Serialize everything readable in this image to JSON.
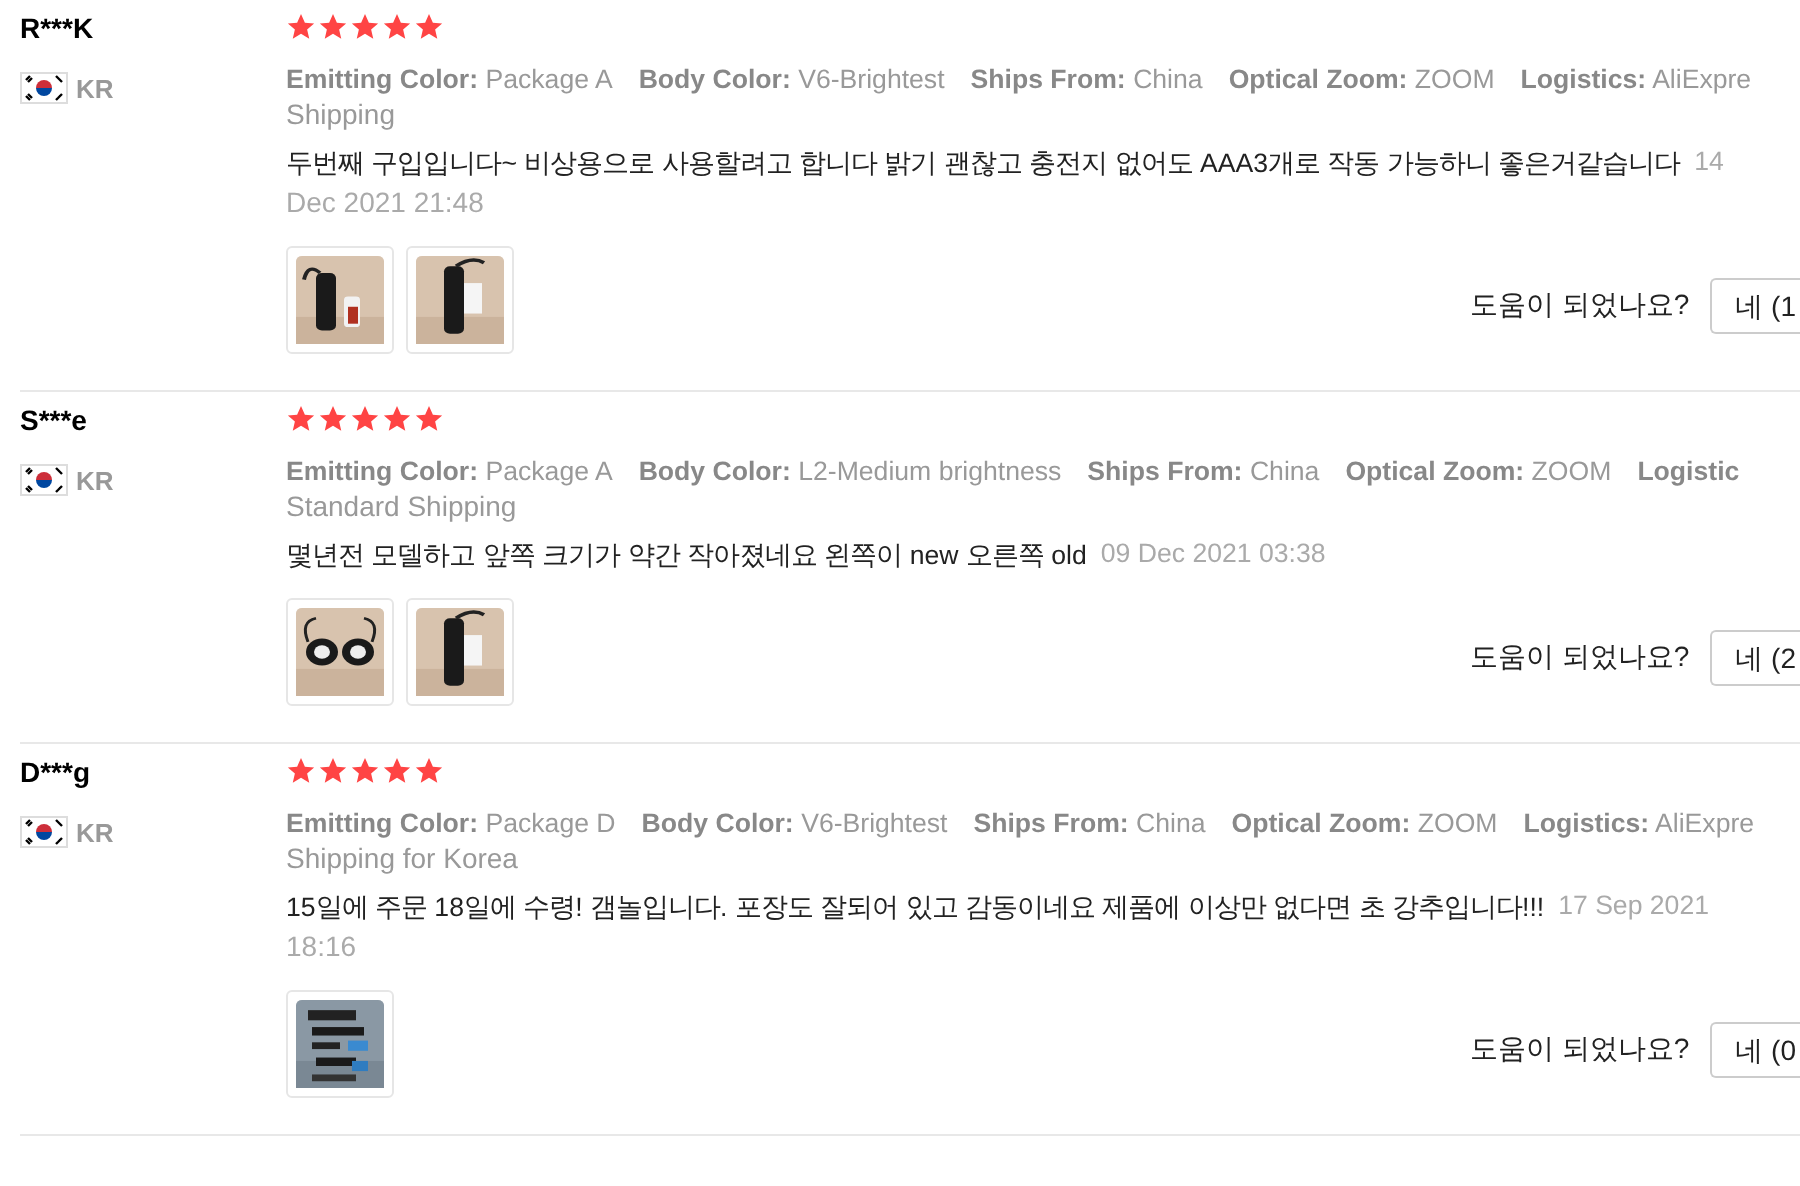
{
  "reviews": [
    {
      "name": "R***K",
      "country": "KR",
      "stars": 5,
      "attributes": [
        {
          "label": "Emitting Color:",
          "value": "Package A"
        },
        {
          "label": "Body Color:",
          "value": "V6-Brightest"
        },
        {
          "label": "Ships From:",
          "value": "China"
        },
        {
          "label": "Optical Zoom:",
          "value": "ZOOM"
        },
        {
          "label": "Logistics:",
          "value": "AliExpre"
        }
      ],
      "attributes_continued": "Shipping",
      "comment": "두번째 구입입니다~ 비상용으로 사용할려고 합니다 밝기 괜찮고 충전지 없어도 AAA3개로 작동 가능하니 좋은거같습니다",
      "date": "14",
      "date_continued": "Dec 2021 21:48",
      "photos": [
        {
          "kind": "picture"
        },
        {
          "kind": "picture"
        }
      ],
      "helpful_prompt": "도움이 되었나요?",
      "helpful_button": "네 (1"
    },
    {
      "name": "S***e",
      "country": "KR",
      "stars": 5,
      "attributes": [
        {
          "label": "Emitting Color:",
          "value": "Package A"
        },
        {
          "label": "Body Color:",
          "value": "L2-Medium brightness"
        },
        {
          "label": "Ships From:",
          "value": "China"
        },
        {
          "label": "Optical Zoom:",
          "value": "ZOOM"
        },
        {
          "label": "Logistic"
        }
      ],
      "attributes_continued": "Standard Shipping",
      "comment": "몇년전 모델하고 앞쪽 크기가 약간 작아졌네요 왼쪽이 new 오른쪽 old",
      "date": "09 Dec 2021 03:38",
      "photos": [
        {
          "kind": "picture"
        },
        {
          "kind": "picture"
        }
      ],
      "helpful_prompt": "도움이 되었나요?",
      "helpful_button": "네 (2"
    },
    {
      "name": "D***g",
      "country": "KR",
      "stars": 5,
      "attributes": [
        {
          "label": "Emitting Color:",
          "value": "Package D"
        },
        {
          "label": "Body Color:",
          "value": "V6-Brightest"
        },
        {
          "label": "Ships From:",
          "value": "China"
        },
        {
          "label": "Optical Zoom:",
          "value": "ZOOM"
        },
        {
          "label": "Logistics:",
          "value": "AliExpre"
        }
      ],
      "attributes_continued": "Shipping for Korea",
      "comment": "15일에 주문 18일에 수령! 갬놀입니다. 포장도 잘되어 있고 감동이네요 제품에 이상만 없다면 초 강추입니다!!!",
      "date": "17 Sep 2021",
      "date_continued": "18:16",
      "photos": [
        {
          "kind": "picture"
        }
      ],
      "helpful_prompt": "도움이 되었나요?",
      "helpful_button": "네 (0"
    }
  ]
}
